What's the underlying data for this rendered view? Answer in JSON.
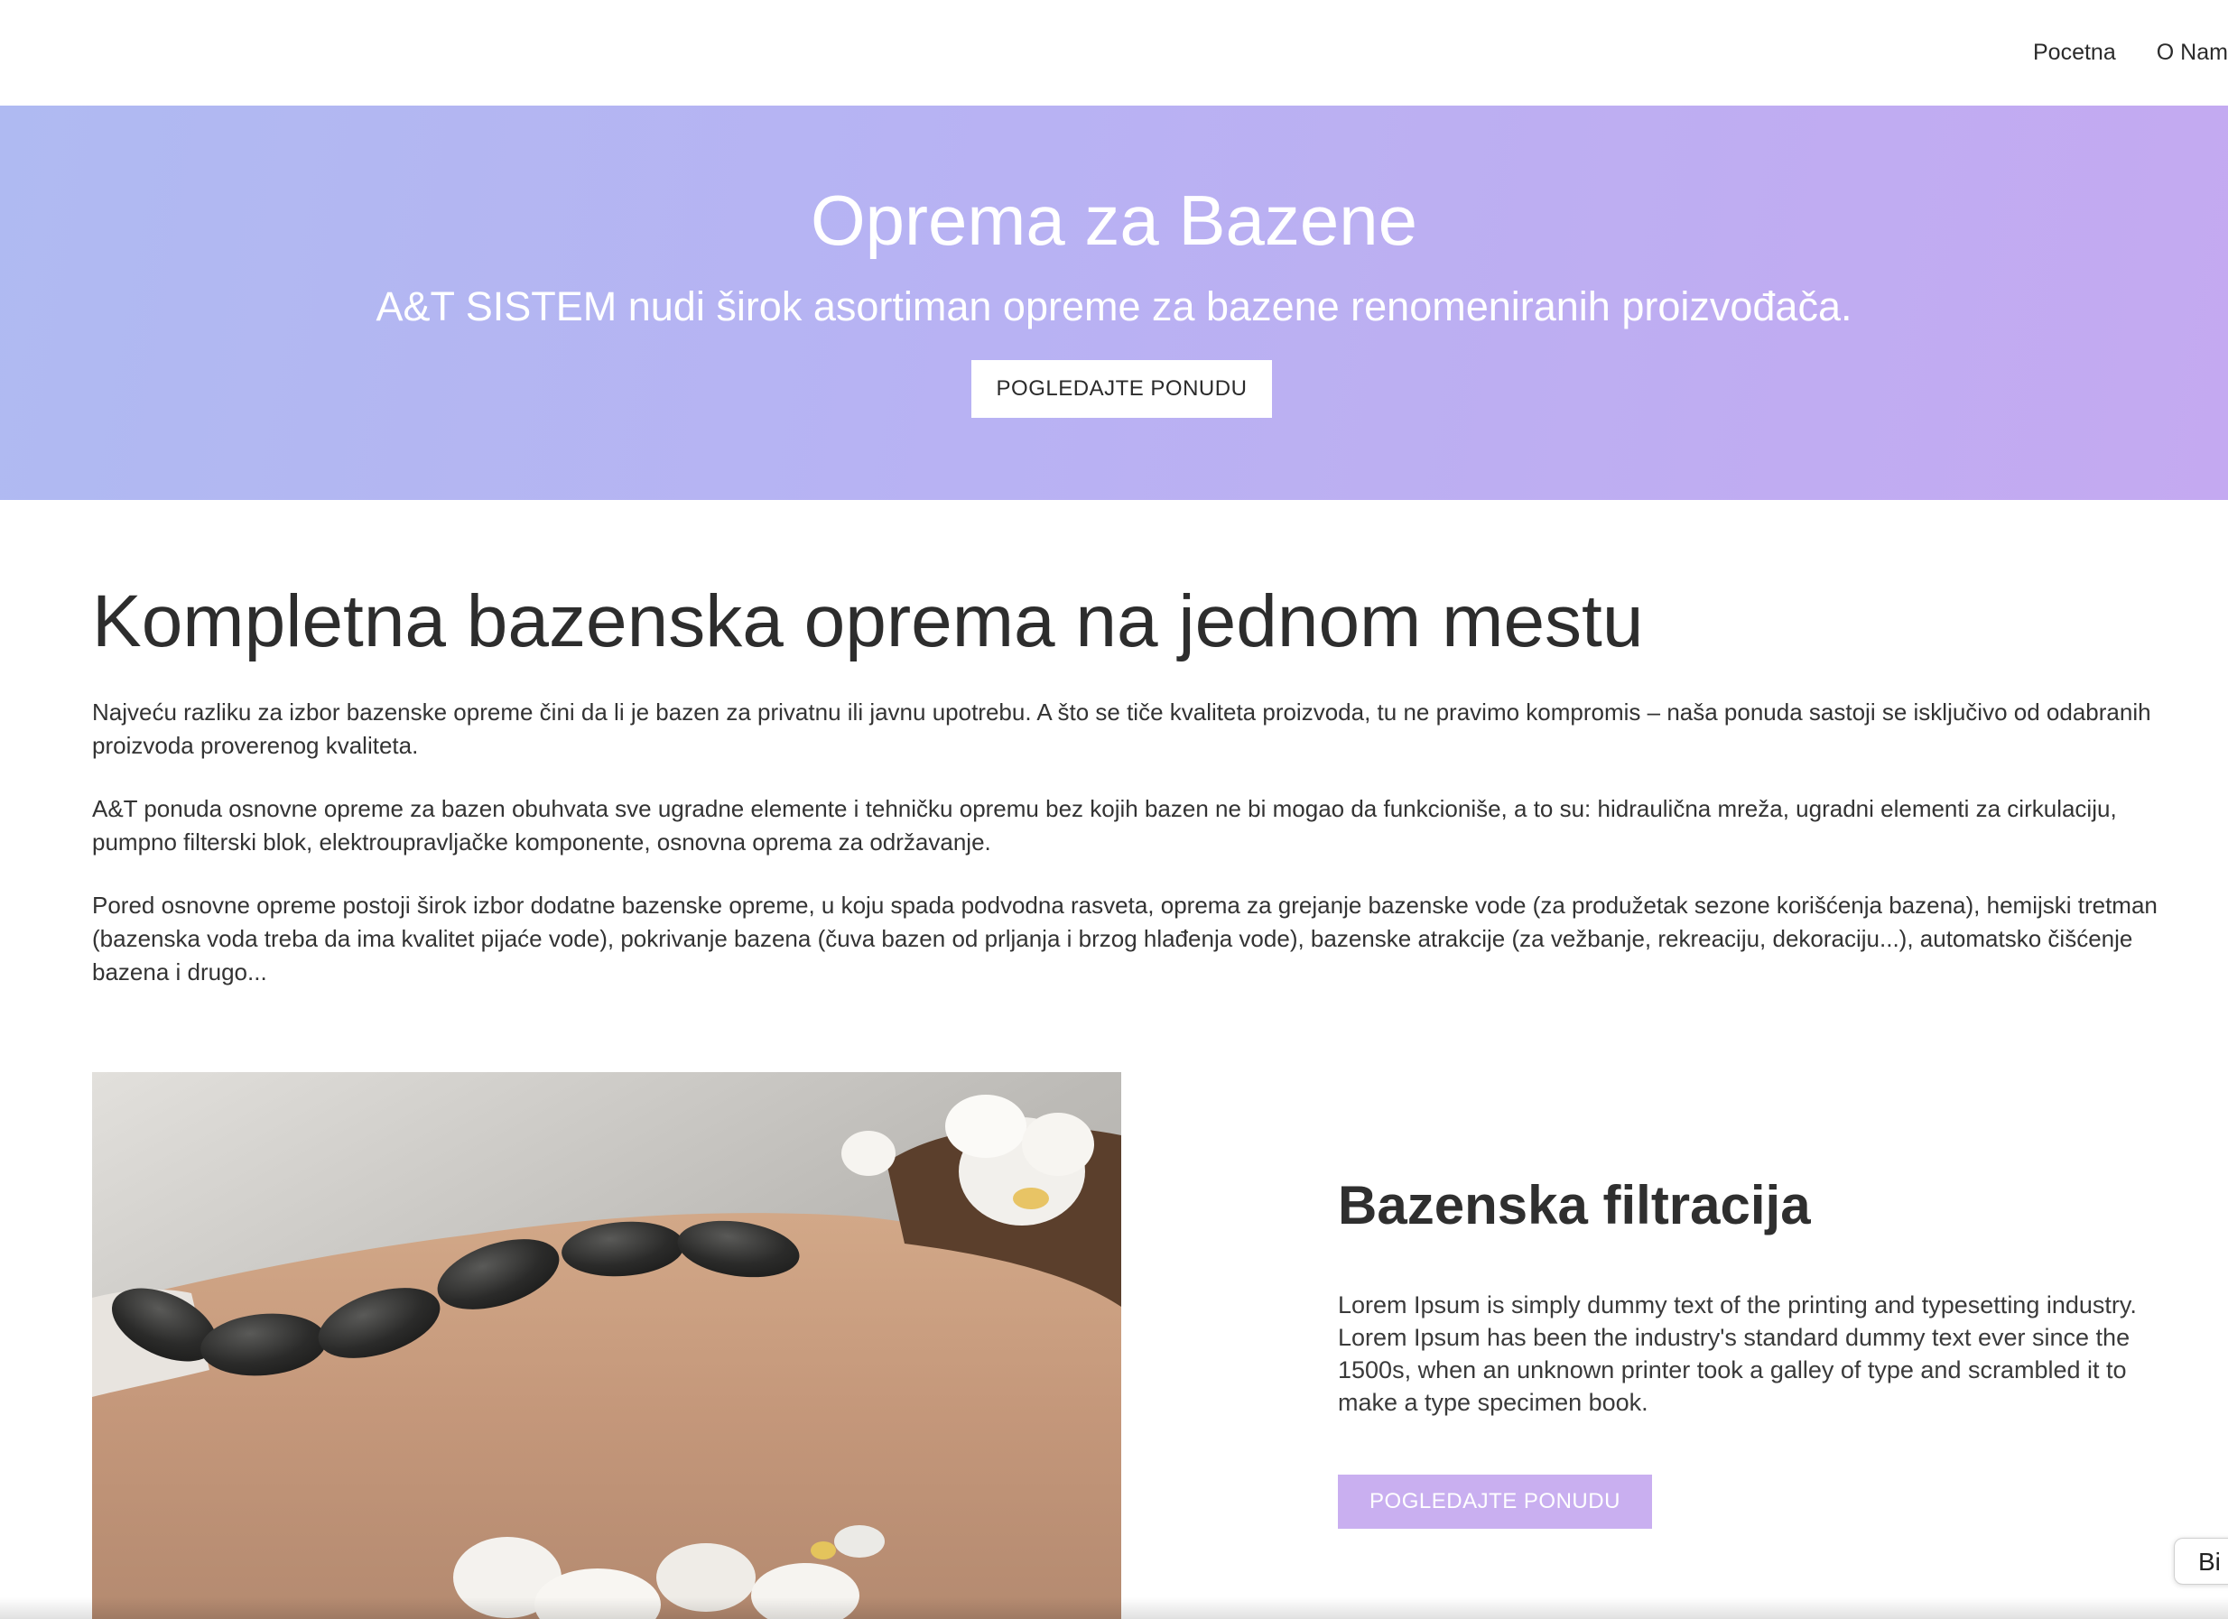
{
  "nav": {
    "items": [
      {
        "label": "Pocetna"
      },
      {
        "label": "O Nama"
      }
    ]
  },
  "hero": {
    "title": "Oprema za Bazene",
    "subtitle": "A&T SISTEM nudi širok asortiman opreme za bazene renomeniranih proizvođača.",
    "button_label": "POGLEDAJTE PONUDU"
  },
  "main": {
    "heading": "Kompletna bazenska oprema na jednom mestu",
    "paragraphs": [
      "Najveću razliku za izbor bazenske opreme čini da li je bazen za privatnu ili javnu upotrebu. A što se tiče kvaliteta proizvoda, tu ne pravimo kompromis – naša ponuda sastoji se isključivo od odabranih proizvoda proverenog kvaliteta.",
      "A&T ponuda osnovne opreme za bazen obuhvata sve ugradne elemente i tehničku opremu bez kojih bazen ne bi mogao da funkcioniše, a to su: hidraulična mreža, ugradni elementi za cirkulaciju, pumpno filterski blok, elektroupravljačke komponente, osnovna oprema za održavanje.",
      "Pored osnovne opreme postoji širok izbor dodatne bazenske opreme, u koju spada podvodna rasveta, oprema za grejanje bazenske vode (za produžetak sezone korišćenja bazena), hemijski tretman (bazenska voda treba da ima kvalitet pijaće vode), pokrivanje bazena (čuva bazen od prljanja i brzog hlađenja vode), bazenske atrakcije (za vežbanje, rekreaciju, dekoraciju...), automatsko čišćenje bazena i drugo..."
    ]
  },
  "feature": {
    "title": "Bazenska filtracija",
    "text": "Lorem Ipsum is simply dummy text of the printing and typesetting industry. Lorem Ipsum has been the industry's standard dummy text ever since the 1500s, when an unknown printer took a galley of type and scrambled it to make a type specimen book.",
    "button_label": "POGLEDAJTE PONUDU"
  },
  "chat": {
    "label": "Bi"
  },
  "colors": {
    "hero_gradient_start": "#afbaf2",
    "hero_gradient_end": "#c4a9f1",
    "accent_button": "#c9aff0",
    "text": "#2f2f2f"
  }
}
